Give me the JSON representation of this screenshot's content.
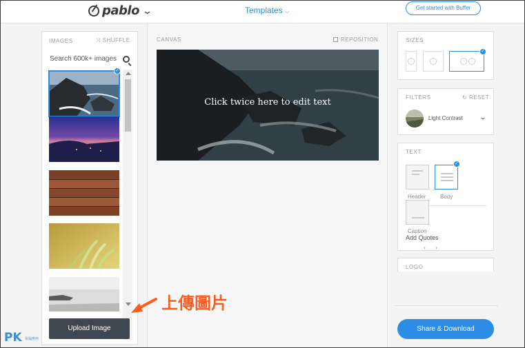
{
  "header": {
    "logo_text": "pablo",
    "templates_label": "Templates",
    "get_started_label": "Get started with Buffer"
  },
  "images_panel": {
    "title": "IMAGES",
    "shuffle_label": "SHUFFLE",
    "search_placeholder": "Search 600k+ images",
    "upload_label": "Upload Image",
    "thumbnails": [
      "rocky-coast",
      "purple-sunset-bay",
      "wooden-planks",
      "yellow-wheat",
      "misty-lake"
    ],
    "selected_index": 0
  },
  "canvas": {
    "title": "CANVAS",
    "reposition_label": "REPOSITION",
    "overlay_text": "Click twice here to edit text"
  },
  "sizes_panel": {
    "title": "SIZES",
    "options": [
      "pinterest",
      "instagram",
      "facebook-twitter"
    ],
    "selected": "facebook-twitter"
  },
  "filters_panel": {
    "title": "FILTERS",
    "reset_label": "RESET",
    "selected_filter": "Light Contrast"
  },
  "text_panel": {
    "title": "TEXT",
    "header_label": "Header",
    "body_label": "Body",
    "caption_label": "Caption",
    "add_quotes_label": "Add Quotes",
    "body_selected": true
  },
  "logo_panel": {
    "title": "LOGO"
  },
  "share_label": "Share & Download",
  "annotation": {
    "text": "上傳圖片"
  },
  "watermark": {
    "brand": "PK",
    "subtitle": "電腦應用"
  },
  "colors": {
    "accent": "#2b8de0",
    "upload_button": "#3e4750",
    "annotation": "#ff5a1f"
  }
}
